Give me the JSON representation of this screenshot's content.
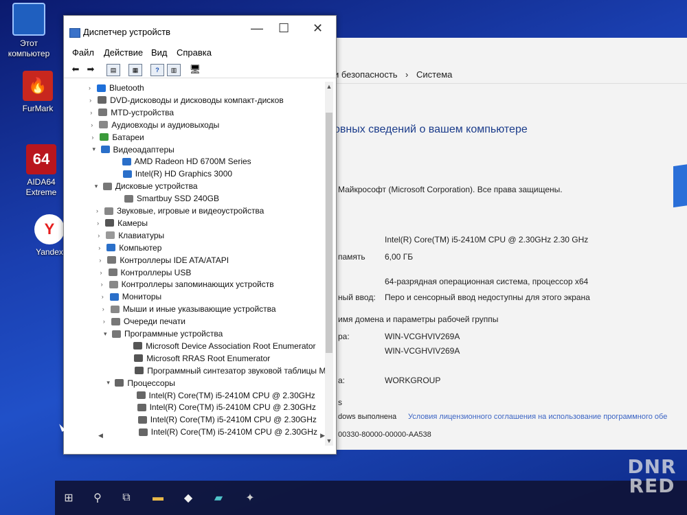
{
  "desktop": {
    "icons": [
      {
        "label": "Этот компьютер"
      },
      {
        "label": "FurMark"
      },
      {
        "label": "AIDA64 Extreme",
        "glyph": "64"
      },
      {
        "label": "Yandex",
        "glyph": "Y"
      }
    ]
  },
  "system_window": {
    "breadcrumb_1": "и безопасность",
    "breadcrumb_sep": "›",
    "breadcrumb_2": "Система",
    "heading": "овных сведений о вашем компьютере",
    "copyright": "Майкрософт (Microsoft Corporation). Все права защищены.",
    "rows": [
      {
        "label": "",
        "value": "Intel(R) Core(TM) i5-2410M CPU @ 2.30GHz   2.30 GHz"
      },
      {
        "label": "память",
        "value": "6,00 ГБ"
      },
      {
        "label": "",
        "value": "64-разрядная операционная система, процессор x64"
      },
      {
        "label": "ный ввод:",
        "value": "Перо и сенсорный ввод недоступны для этого экрана"
      },
      {
        "label": "имя домена и параметры рабочей группы",
        "value": ""
      },
      {
        "label": "ра:",
        "value": "WIN-VCGHVIV269A"
      },
      {
        "label": "",
        "value": "WIN-VCGHVIV269A"
      },
      {
        "label": "а:",
        "value": "WORKGROUP"
      },
      {
        "label": "s",
        "value": ""
      }
    ],
    "activation_label": "dows выполнена",
    "license_link": "Условия лицензионного соглашения на использование программного обе",
    "product_id": "00330-80000-00000-AA538"
  },
  "device_manager": {
    "title": "Диспетчер устройств",
    "controls": {
      "minimize": "—",
      "maximize": "☐",
      "close": "✕"
    },
    "menu": [
      "Файл",
      "Действие",
      "Вид",
      "Справка"
    ],
    "toolbar_icons": [
      "back-arrow-icon",
      "forward-arrow-icon",
      "properties-icon",
      "update-driver-icon",
      "help-icon",
      "view-icon",
      "monitor-icon"
    ],
    "toolbar_glyphs": [
      "⬅",
      "➡",
      "▤",
      "▦",
      "?",
      "▥",
      "🖥"
    ],
    "tree": [
      {
        "label": "Bluetooth",
        "level": 0,
        "expanded": false,
        "color": "#1e6fd9"
      },
      {
        "label": "DVD-дисководы и дисководы компакт-дисков",
        "level": 0,
        "expanded": false,
        "color": "#666"
      },
      {
        "label": "MTD-устройства",
        "level": 0,
        "expanded": false,
        "color": "#777"
      },
      {
        "label": "Аудиовходы и аудиовыходы",
        "level": 0,
        "expanded": false,
        "color": "#888"
      },
      {
        "label": "Батареи",
        "level": 0,
        "expanded": false,
        "color": "#3a9a3a"
      },
      {
        "label": "Видеоадаптеры",
        "level": 0,
        "expanded": true,
        "color": "#2a6fc9"
      },
      {
        "label": "AMD Radeon HD 6700M Series",
        "level": 1,
        "color": "#2a6fc9"
      },
      {
        "label": "Intel(R) HD Graphics 3000",
        "level": 1,
        "color": "#2a6fc9"
      },
      {
        "label": "Дисковые устройства",
        "level": 0,
        "expanded": true,
        "color": "#777"
      },
      {
        "label": "Smartbuy SSD 240GB",
        "level": 1,
        "color": "#777"
      },
      {
        "label": "Звуковые, игровые и видеоустройства",
        "level": 0,
        "expanded": false,
        "color": "#888"
      },
      {
        "label": "Камеры",
        "level": 0,
        "expanded": false,
        "color": "#555"
      },
      {
        "label": "Клавиатуры",
        "level": 0,
        "expanded": false,
        "color": "#999"
      },
      {
        "label": "Компьютер",
        "level": 0,
        "expanded": false,
        "color": "#2a6fc9"
      },
      {
        "label": "Контроллеры IDE ATA/ATAPI",
        "level": 0,
        "expanded": false,
        "color": "#777"
      },
      {
        "label": "Контроллеры USB",
        "level": 0,
        "expanded": false,
        "color": "#777"
      },
      {
        "label": "Контроллеры запоминающих устройств",
        "level": 0,
        "expanded": false,
        "color": "#888"
      },
      {
        "label": "Мониторы",
        "level": 0,
        "expanded": false,
        "color": "#2a6fc9"
      },
      {
        "label": "Мыши и иные указывающие устройства",
        "level": 0,
        "expanded": false,
        "color": "#888"
      },
      {
        "label": "Очереди печати",
        "level": 0,
        "expanded": false,
        "color": "#777"
      },
      {
        "label": "Программные устройства",
        "level": 0,
        "expanded": true,
        "color": "#777"
      },
      {
        "label": "Microsoft Device Association Root Enumerator",
        "level": 1,
        "color": "#555"
      },
      {
        "label": "Microsoft RRAS Root Enumerator",
        "level": 1,
        "color": "#555"
      },
      {
        "label": "Программный синтезатор звуковой таблицы Mic",
        "level": 1,
        "color": "#555"
      },
      {
        "label": "Процессоры",
        "level": 0,
        "expanded": true,
        "color": "#666"
      },
      {
        "label": "Intel(R) Core(TM) i5-2410M CPU @ 2.30GHz",
        "level": 1,
        "color": "#666"
      },
      {
        "label": "Intel(R) Core(TM) i5-2410M CPU @ 2.30GHz",
        "level": 1,
        "color": "#666"
      },
      {
        "label": "Intel(R) Core(TM) i5-2410M CPU @ 2.30GHz",
        "level": 1,
        "color": "#666"
      },
      {
        "label": "Intel(R) Core(TM) i5-2410M CPU @ 2.30GHz",
        "level": 1,
        "color": "#666"
      }
    ]
  },
  "taskbar": {
    "icons": [
      "windows-start-icon",
      "search-icon",
      "task-view-icon",
      "file-explorer-icon",
      "app-icon",
      "app-icon-2",
      "app-icon-3"
    ],
    "glyphs": [
      "⊞",
      "⚲",
      "⧉",
      "▬",
      "◆",
      "▰",
      "✦"
    ]
  },
  "watermark": {
    "line1": "DNR",
    "line2": "RED"
  }
}
